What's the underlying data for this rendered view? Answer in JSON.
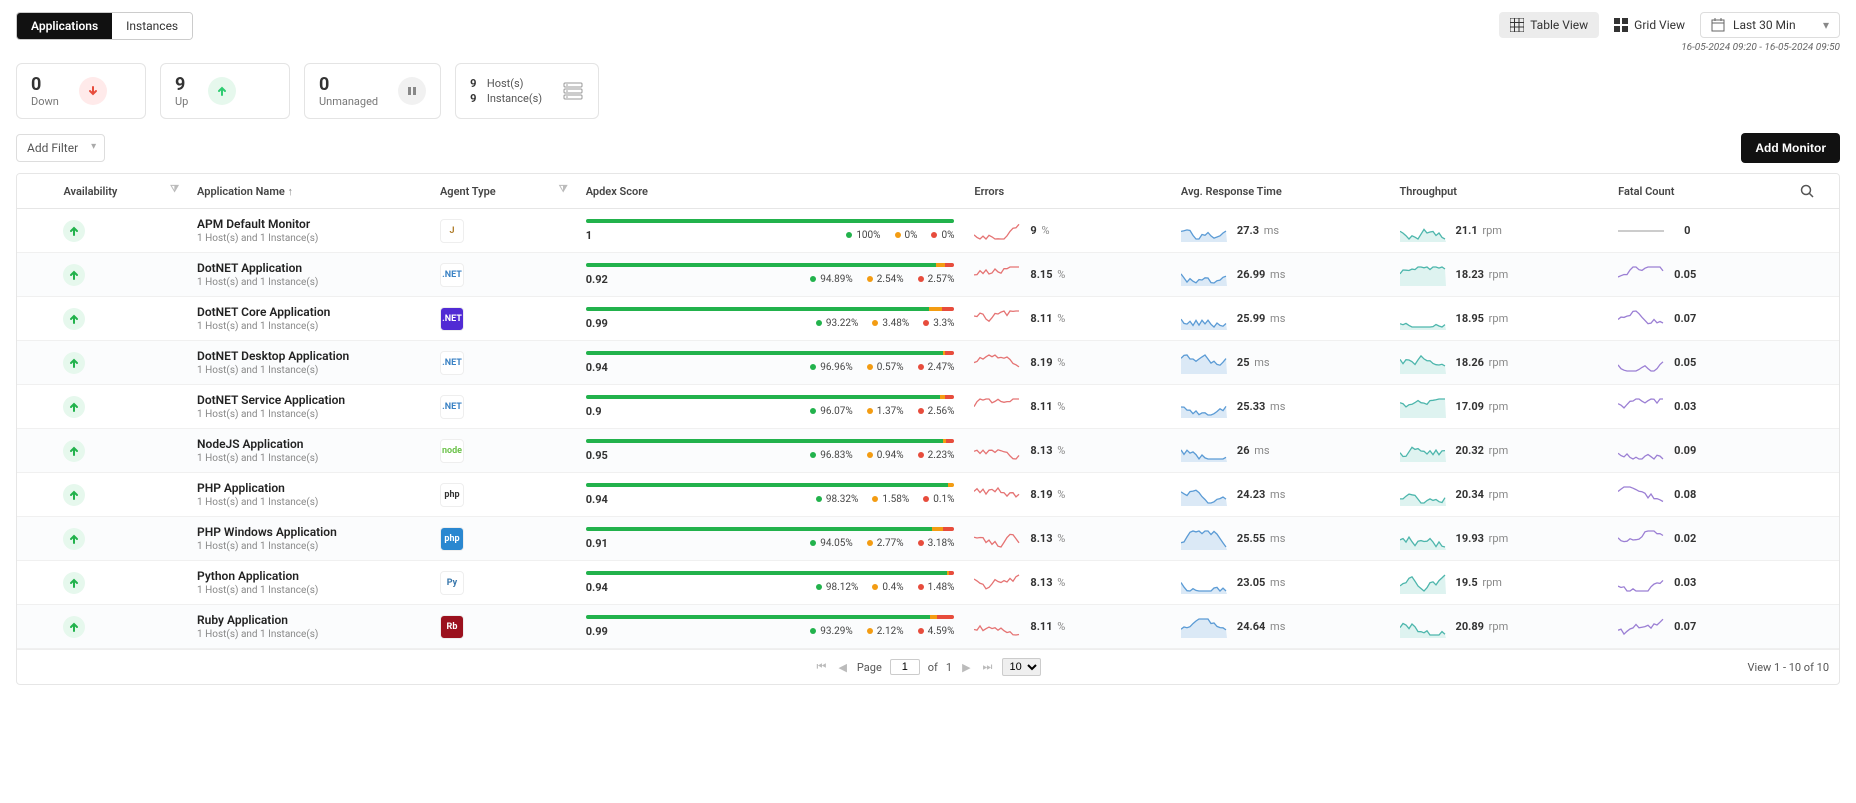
{
  "tabs": {
    "applications": "Applications",
    "instances": "Instances"
  },
  "views": {
    "table": "Table View",
    "grid": "Grid View"
  },
  "time": {
    "label": "Last 30 Min",
    "range": "16-05-2024 09:20 - 16-05-2024 09:50"
  },
  "cards": {
    "down": {
      "value": "0",
      "label": "Down"
    },
    "up": {
      "value": "9",
      "label": "Up"
    },
    "unmanaged": {
      "value": "0",
      "label": "Unmanaged"
    },
    "hosts": {
      "hosts_num": "9",
      "hosts_label": "Host(s)",
      "inst_num": "9",
      "inst_label": "Instance(s)"
    }
  },
  "filter": {
    "add_filter": "Add Filter",
    "add_monitor": "Add Monitor"
  },
  "columns": {
    "availability": "Availability",
    "app_name": "Application Name",
    "agent_type": "Agent Type",
    "apdex": "Apdex Score",
    "errors": "Errors",
    "resp": "Avg. Response Time",
    "throughput": "Throughput",
    "fatal": "Fatal Count"
  },
  "rows": [
    {
      "name": "APM Default Monitor",
      "sub": "1 Host(s) and 1 Instance(s)",
      "agent": "java",
      "apdex": "1",
      "p": [
        "100%",
        "0%",
        "0%"
      ],
      "bar": [
        100,
        0,
        0
      ],
      "err": "9",
      "erru": "%",
      "resp": "27.3",
      "respu": "ms",
      "thr": "21.1",
      "thru": "rpm",
      "fatal": "0",
      "fatalFlat": true
    },
    {
      "name": "DotNET Application",
      "sub": "1 Host(s) and 1 Instance(s)",
      "agent": "dotnet",
      "apdex": "0.92",
      "p": [
        "94.89%",
        "2.54%",
        "2.57%"
      ],
      "bar": [
        94.89,
        2.54,
        2.57
      ],
      "err": "8.15",
      "erru": "%",
      "resp": "26.99",
      "respu": "ms",
      "thr": "18.23",
      "thru": "rpm",
      "fatal": "0.05"
    },
    {
      "name": "DotNET Core Application",
      "sub": "1 Host(s) and 1 Instance(s)",
      "agent": "dotnetcore",
      "apdex": "0.99",
      "p": [
        "93.22%",
        "3.48%",
        "3.3%"
      ],
      "bar": [
        93.22,
        3.48,
        3.3
      ],
      "err": "8.11",
      "erru": "%",
      "resp": "25.99",
      "respu": "ms",
      "thr": "18.95",
      "thru": "rpm",
      "fatal": "0.07"
    },
    {
      "name": "DotNET Desktop Application",
      "sub": "1 Host(s) and 1 Instance(s)",
      "agent": "dotnet",
      "apdex": "0.94",
      "p": [
        "96.96%",
        "0.57%",
        "2.47%"
      ],
      "bar": [
        96.96,
        0.57,
        2.47
      ],
      "err": "8.19",
      "erru": "%",
      "resp": "25",
      "respu": "ms",
      "thr": "18.26",
      "thru": "rpm",
      "fatal": "0.05"
    },
    {
      "name": "DotNET Service Application",
      "sub": "1 Host(s) and 1 Instance(s)",
      "agent": "dotnet",
      "apdex": "0.9",
      "p": [
        "96.07%",
        "1.37%",
        "2.56%"
      ],
      "bar": [
        96.07,
        1.37,
        2.56
      ],
      "err": "8.11",
      "erru": "%",
      "resp": "25.33",
      "respu": "ms",
      "thr": "17.09",
      "thru": "rpm",
      "fatal": "0.03"
    },
    {
      "name": "NodeJS Application",
      "sub": "1 Host(s) and 1 Instance(s)",
      "agent": "node",
      "apdex": "0.95",
      "p": [
        "96.83%",
        "0.94%",
        "2.23%"
      ],
      "bar": [
        96.83,
        0.94,
        2.23
      ],
      "err": "8.13",
      "erru": "%",
      "resp": "26",
      "respu": "ms",
      "thr": "20.32",
      "thru": "rpm",
      "fatal": "0.09"
    },
    {
      "name": "PHP Application",
      "sub": "1 Host(s) and 1 Instance(s)",
      "agent": "php",
      "apdex": "0.94",
      "p": [
        "98.32%",
        "1.58%",
        "0.1%"
      ],
      "bar": [
        98.32,
        1.58,
        0.1
      ],
      "err": "8.19",
      "erru": "%",
      "resp": "24.23",
      "respu": "ms",
      "thr": "20.34",
      "thru": "rpm",
      "fatal": "0.08"
    },
    {
      "name": "PHP Windows Application",
      "sub": "1 Host(s) and 1 Instance(s)",
      "agent": "phpwin",
      "apdex": "0.91",
      "p": [
        "94.05%",
        "2.77%",
        "3.18%"
      ],
      "bar": [
        94.05,
        2.77,
        3.18
      ],
      "err": "8.13",
      "erru": "%",
      "resp": "25.55",
      "respu": "ms",
      "thr": "19.93",
      "thru": "rpm",
      "fatal": "0.02"
    },
    {
      "name": "Python Application",
      "sub": "1 Host(s) and 1 Instance(s)",
      "agent": "python",
      "apdex": "0.94",
      "p": [
        "98.12%",
        "0.4%",
        "1.48%"
      ],
      "bar": [
        98.12,
        0.4,
        1.48
      ],
      "err": "8.13",
      "erru": "%",
      "resp": "23.05",
      "respu": "ms",
      "thr": "19.5",
      "thru": "rpm",
      "fatal": "0.03"
    },
    {
      "name": "Ruby Application",
      "sub": "1 Host(s) and 1 Instance(s)",
      "agent": "ruby",
      "apdex": "0.99",
      "p": [
        "93.29%",
        "2.12%",
        "4.59%"
      ],
      "bar": [
        93.29,
        2.12,
        4.59
      ],
      "err": "8.11",
      "erru": "%",
      "resp": "24.64",
      "respu": "ms",
      "thr": "20.89",
      "thru": "rpm",
      "fatal": "0.07"
    }
  ],
  "pager": {
    "page_label": "Page",
    "of_label": "of",
    "page": "1",
    "total_pages": "1",
    "page_size": "10",
    "view_info": "View 1 - 10 of 10"
  },
  "agent_colors": {
    "java": {
      "bg": "#fff",
      "fg": "#b07d2b",
      "txt": "J"
    },
    "dotnet": {
      "bg": "#fff",
      "fg": "#3b82c4",
      "txt": ".NET"
    },
    "dotnetcore": {
      "bg": "#512bd4",
      "fg": "#fff",
      "txt": ".NET"
    },
    "node": {
      "bg": "#fff",
      "fg": "#6cc24a",
      "txt": "node"
    },
    "php": {
      "bg": "#fff",
      "fg": "#333",
      "txt": "php"
    },
    "phpwin": {
      "bg": "#2a87d0",
      "fg": "#fff",
      "txt": "php"
    },
    "python": {
      "bg": "#fff",
      "fg": "#3776ab",
      "txt": "Py"
    },
    "ruby": {
      "bg": "#9b111e",
      "fg": "#fff",
      "txt": "Rb"
    }
  }
}
